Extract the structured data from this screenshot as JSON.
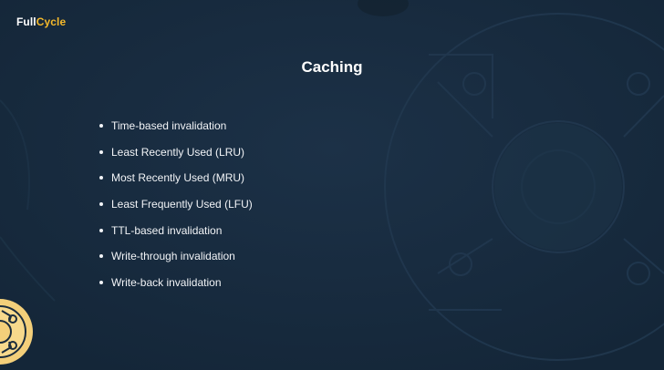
{
  "brand": {
    "name_part1": "Full",
    "name_part2": "Cycle",
    "accent_color": "#f5b92b"
  },
  "slide": {
    "title": "Caching",
    "bullets": [
      "Time-based invalidation",
      "Least Recently Used (LRU)",
      "Most Recently Used (MRU)",
      "Least Frequently Used (LFU)",
      "TTL-based invalidation",
      "Write-through invalidation",
      "Write-back invalidation"
    ]
  },
  "colors": {
    "background": "#172a3e",
    "text": "#ffffff"
  },
  "icons": {
    "background_watermark": "cycle-gear-watermark-icon",
    "corner_badge": "cycle-badge-icon"
  }
}
